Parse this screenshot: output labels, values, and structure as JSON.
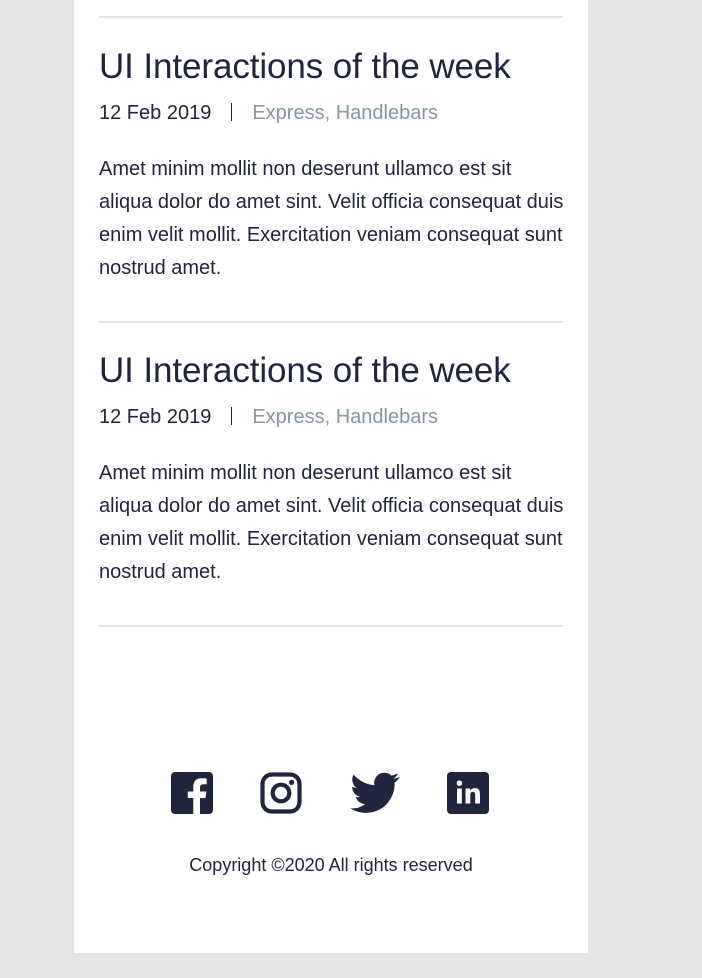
{
  "posts": [
    {
      "title": "UI Interactions of the week",
      "date": "12 Feb 2019",
      "tags": "Express, Handlebars",
      "body": "Amet minim mollit non deserunt ullamco est sit aliqua dolor do amet sint. Velit officia consequat duis enim velit mollit. Exercitation veniam consequat sunt nostrud amet."
    },
    {
      "title": "UI Interactions of the week",
      "date": "12 Feb 2019",
      "tags": "Express, Handlebars",
      "body": "Amet minim mollit non deserunt ullamco est sit aliqua dolor do amet sint. Velit officia consequat duis enim velit mollit. Exercitation veniam consequat sunt nostrud amet."
    }
  ],
  "footer": {
    "social_icons": [
      "facebook-icon",
      "instagram-icon",
      "twitter-icon",
      "linkedin-icon"
    ],
    "copyright": "Copyright ©2020 All rights reserved"
  },
  "colors": {
    "text": "#21243d",
    "tags": "#8695a4",
    "divider": "#e3e3e3",
    "page_background": "#e5e5e5",
    "panel_background": "#ffffff"
  }
}
